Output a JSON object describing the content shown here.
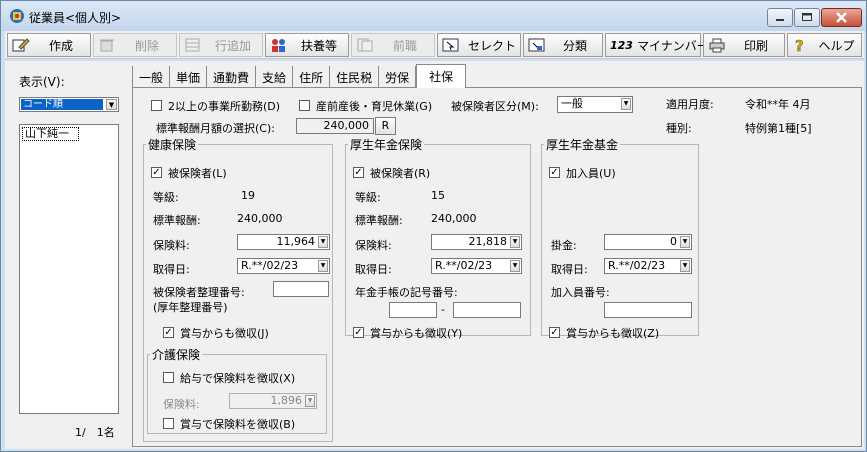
{
  "window": {
    "title": "従業員<個人別>"
  },
  "toolbar": {
    "buttons": [
      {
        "label": "作成",
        "icon": "create-icon",
        "enabled": true
      },
      {
        "label": "削除",
        "icon": "delete-icon",
        "enabled": false
      },
      {
        "label": "行追加",
        "icon": "add-row-icon",
        "enabled": false
      },
      {
        "label": "扶養等",
        "icon": "dependents-icon",
        "enabled": true
      },
      {
        "label": "前職",
        "icon": "previous-job-icon",
        "enabled": false
      },
      {
        "label": "セレクト",
        "icon": "select-icon",
        "enabled": true
      },
      {
        "label": "分類",
        "icon": "classify-icon",
        "enabled": true
      },
      {
        "label": "マイナンバー",
        "icon": "mynumber-icon",
        "enabled": true
      },
      {
        "label": "印刷",
        "icon": "printer-icon",
        "enabled": true
      },
      {
        "label": "ヘルプ",
        "icon": "help-icon",
        "enabled": true
      }
    ]
  },
  "left": {
    "display_label": "表示(V):",
    "sort_value": "コード順",
    "list_items": [
      "山下純一"
    ],
    "page_count": "1/　1名"
  },
  "tabs": [
    "一般",
    "単価",
    "通勤費",
    "支給",
    "住所",
    "住民税",
    "労保",
    "社保"
  ],
  "active_tab": 7,
  "top": {
    "multi_office_label": "2以上の事業所勤務(D)",
    "maternity_label": "産前産後・育児休業(G)",
    "insured_type_label": "被保険者区分(M):",
    "insured_type_value": "一般",
    "standard_selection_label": "標準報酬月額の選択(C):",
    "standard_selection_value": "240,000",
    "standard_selection_btn": "R",
    "apply_month_label": "適用月度:",
    "apply_month_value": "令和**年 4月",
    "kind_label": "種別:",
    "kind_value": "特例第1種[5]"
  },
  "health": {
    "legend": "健康保険",
    "insured_label": "被保険者(L)",
    "grade_label": "等級:",
    "grade_value": "19",
    "std_label": "標準報酬:",
    "std_value": "240,000",
    "premium_label": "保険料:",
    "premium_value": "11,964",
    "acquired_label": "取得日:",
    "acquired_value": "R.**/02/23",
    "number_label": "被保険者整理番号:",
    "number_sub": "(厚年整理番号)",
    "bonus_label": "賞与からも徴収(J)"
  },
  "care": {
    "legend": "介護保険",
    "salary_label": "給与で保険料を徴収(X)",
    "premium_label": "保険料:",
    "premium_value": "1,896",
    "bonus_label": "賞与で保険料を徴収(B)"
  },
  "pension": {
    "legend": "厚生年金保険",
    "insured_label": "被保険者(R)",
    "grade_label": "等級:",
    "grade_value": "15",
    "std_label": "標準報酬:",
    "std_value": "240,000",
    "premium_label": "保険料:",
    "premium_value": "21,818",
    "acquired_label": "取得日:",
    "acquired_value": "R.**/02/23",
    "book_label": "年金手帳の記号番号:",
    "book_sep": "-",
    "bonus_label": "賞与からも徴収(Y)"
  },
  "fund": {
    "legend": "厚生年金基金",
    "member_label": "加入員(U)",
    "contribution_label": "掛金:",
    "contribution_value": "0",
    "acquired_label": "取得日:",
    "acquired_value": "R.**/02/23",
    "member_no_label": "加入員番号:",
    "bonus_label": "賞与からも徴収(Z)"
  },
  "colors": {
    "titlebar": "#c3d6ec",
    "face": "#f0f0f0",
    "selection": "#0a64c8",
    "close": "#c75037"
  }
}
